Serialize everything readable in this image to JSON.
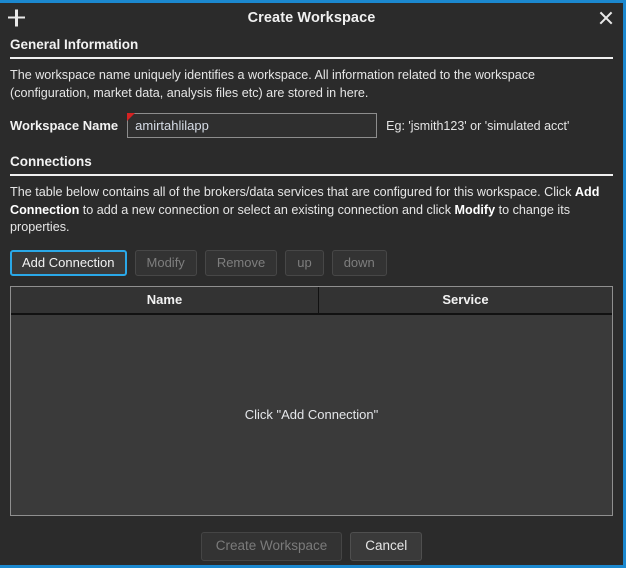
{
  "window": {
    "title": "Create Workspace",
    "add_icon": "plus-icon",
    "close_icon": "close-icon",
    "accent_color": "#1b88cf"
  },
  "general": {
    "heading": "General Information",
    "description": "The workspace name uniquely identifies a workspace. All information related to the workspace (configuration, market data, analysis files etc) are stored in here.",
    "name_label": "Workspace Name",
    "name_value": "amirtahlilapp",
    "name_placeholder": "",
    "name_hint": "Eg: 'jsmith123' or 'simulated acct'",
    "required_marker_color": "#d42222"
  },
  "connections": {
    "heading": "Connections",
    "description_part1": "The table below contains all of the brokers/data services that are configured for this workspace. Click ",
    "description_bold1": "Add Connection",
    "description_part2": " to add a new connection or select an existing connection and click ",
    "description_bold2": "Modify",
    "description_part3": " to change its properties.",
    "toolbar": [
      {
        "label": "Add Connection",
        "state": "focused"
      },
      {
        "label": "Modify",
        "state": "disabled"
      },
      {
        "label": "Remove",
        "state": "disabled"
      },
      {
        "label": "up",
        "state": "disabled"
      },
      {
        "label": "down",
        "state": "disabled"
      }
    ],
    "table": {
      "columns": [
        "Name",
        "Service"
      ],
      "rows": [],
      "empty_message": "Click \"Add Connection\""
    }
  },
  "footer": {
    "create_label": "Create Workspace",
    "create_state": "disabled",
    "cancel_label": "Cancel",
    "cancel_state": "enabled"
  }
}
